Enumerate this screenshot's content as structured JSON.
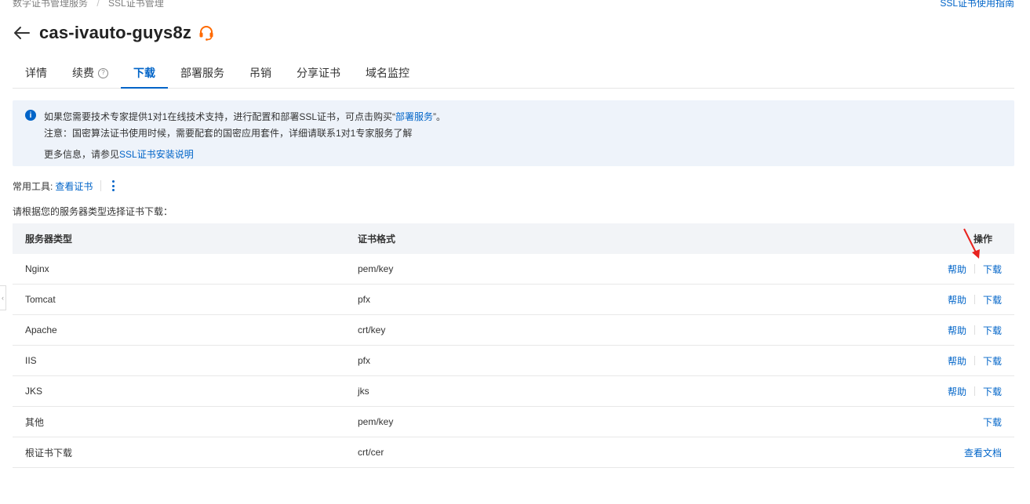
{
  "breadcrumb": {
    "items": [
      "数字证书管理服务",
      "SSL证书管理"
    ]
  },
  "guide_link": "SSL证书使用指南",
  "title": "cas-ivauto-guys8z",
  "tabs": [
    {
      "label": "详情"
    },
    {
      "label": "续费"
    },
    {
      "label": "下载"
    },
    {
      "label": "部署服务"
    },
    {
      "label": "吊销"
    },
    {
      "label": "分享证书"
    },
    {
      "label": "域名监控"
    }
  ],
  "active_tab": "下载",
  "notice": {
    "line1_prefix": "如果您需要技术专家提供1对1在线技术支持，进行配置和部署SSL证书，可点击购买“",
    "line1_link": "部署服务",
    "line1_suffix": "”。",
    "line2": "注意：国密算法证书使用时候，需要配套的国密应用套件，详细请联系1对1专家服务了解",
    "line3_prefix": "更多信息，请参见",
    "line3_link": "SSL证书安装说明"
  },
  "tools": {
    "label": "常用工具:",
    "view_cert": "查看证书"
  },
  "hint": "请根据您的服务器类型选择证书下载：",
  "table": {
    "headers": {
      "server_type": "服务器类型",
      "format": "证书格式",
      "actions": "操作"
    },
    "rows": [
      {
        "server": "Nginx",
        "format": "pem/key",
        "help": "帮助",
        "action": "下载"
      },
      {
        "server": "Tomcat",
        "format": "pfx",
        "help": "帮助",
        "action": "下载"
      },
      {
        "server": "Apache",
        "format": "crt/key",
        "help": "帮助",
        "action": "下载"
      },
      {
        "server": "IIS",
        "format": "pfx",
        "help": "帮助",
        "action": "下载"
      },
      {
        "server": "JKS",
        "format": "jks",
        "help": "帮助",
        "action": "下载"
      },
      {
        "server": "其他",
        "format": "pem/key",
        "action": "下载"
      },
      {
        "server": "根证书下载",
        "format": "crt/cer",
        "action": "查看文档"
      }
    ]
  },
  "colors": {
    "accent": "#0064c8",
    "support_icon": "#ff6a00",
    "annotation": "#e8231e"
  }
}
